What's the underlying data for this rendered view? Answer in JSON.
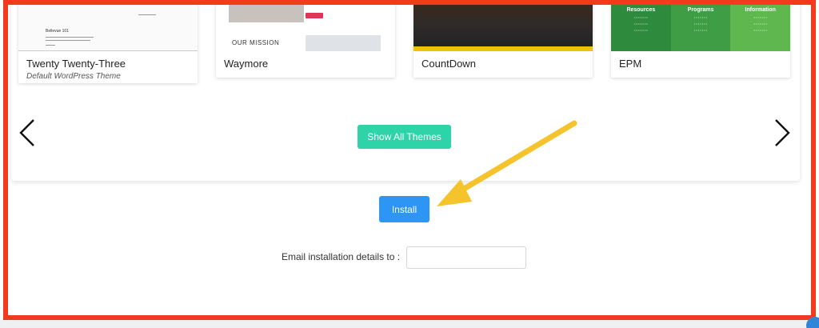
{
  "colors": {
    "highlight_border": "#f23a1e",
    "show_all_button": "#2ed3a8",
    "install_button": "#2d95f3",
    "callout_arrow": "#f5c32c",
    "epm_green_dark": "#2e8b3e",
    "epm_green_light": "#5fb84f"
  },
  "themes": [
    {
      "name": "Twenty Twenty-Three",
      "description": "Default WordPress Theme",
      "thumbnail_text": {
        "title": "Bellevue 101"
      }
    },
    {
      "name": "Waymore",
      "thumbnail_text": {
        "mission": "OUR MISSION"
      }
    },
    {
      "name": "CountDown"
    },
    {
      "name": "EPM",
      "thumbnail_text": {
        "columns": [
          "Resources",
          "Programs",
          "Information"
        ]
      }
    }
  ],
  "navigation": {
    "prev_icon": "chevron-left-icon",
    "next_icon": "chevron-right-icon"
  },
  "show_all_label": "Show All Themes",
  "install_label": "Install",
  "email": {
    "label": "Email installation details to :",
    "value": "",
    "placeholder": ""
  }
}
